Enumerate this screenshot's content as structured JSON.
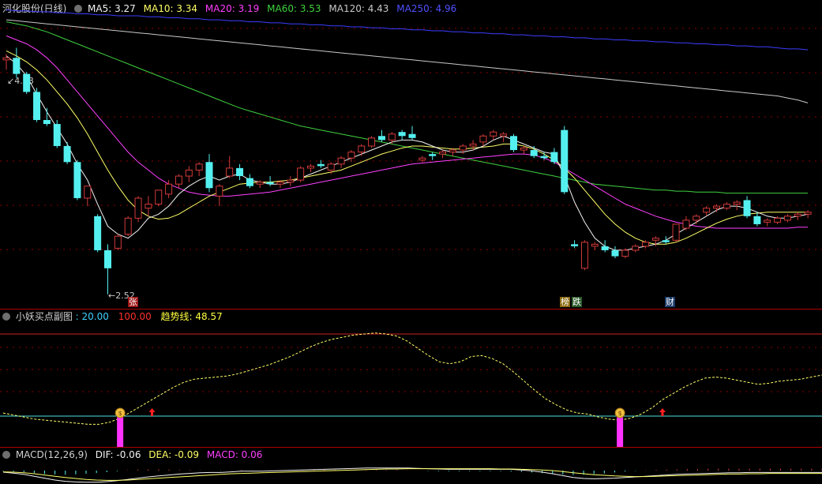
{
  "colors": {
    "bg": "#000000",
    "up": "#d23a3a",
    "down": "#54f0f0",
    "ma5": "#f2f2f2",
    "ma10": "#ffff66",
    "ma20": "#ff40ff",
    "ma60": "#3fd13f",
    "ma120": "#c8c8c8",
    "ma250": "#3c3cff",
    "grid": "#8b0000",
    "signal": "#ff33ff",
    "baseline": "#4fe0e0",
    "trend": "#ffff66"
  },
  "main": {
    "title": "河化股份(日线)",
    "ma5_label": "MA5: 3.27",
    "ma10_label": "MA10: 3.34",
    "ma20_label": "MA20: 3.19",
    "ma60_label": "MA60: 3.53",
    "ma120_label": "MA120: 4.43",
    "ma250_label": "MA250: 4.96",
    "high_marker": "4.98",
    "low_marker": "2.52",
    "tags": [
      "张",
      "榜",
      "跌",
      "财"
    ]
  },
  "sub1": {
    "title": "小妖买点副图",
    "v1_label": ": 20.00",
    "v2_label": "100.00",
    "trend_label": "趋势线: 48.57",
    "signal_icon": "$"
  },
  "sub2": {
    "title": "MACD(12,26,9)",
    "dif_label": "DIF: -0.06",
    "dea_label": "DEA: -0.09",
    "macd_label": "MACD: 0.06"
  },
  "chart_data": {
    "type": "candlestick",
    "price_ylim": [
      2.4,
      5.3
    ],
    "ohlc": [
      [
        4.86,
        4.92,
        4.76,
        4.88
      ],
      [
        4.88,
        4.98,
        4.68,
        4.72
      ],
      [
        4.72,
        4.74,
        4.52,
        4.54
      ],
      [
        4.54,
        4.58,
        4.24,
        4.26
      ],
      [
        4.26,
        4.38,
        4.2,
        4.22
      ],
      [
        4.22,
        4.26,
        3.98,
        4.0
      ],
      [
        4.0,
        4.04,
        3.82,
        3.84
      ],
      [
        3.84,
        3.86,
        3.46,
        3.48
      ],
      [
        3.48,
        3.6,
        3.4,
        3.6
      ],
      [
        3.3,
        3.32,
        2.94,
        2.96
      ],
      [
        2.96,
        3.02,
        2.52,
        2.78
      ],
      [
        2.98,
        3.12,
        2.96,
        3.1
      ],
      [
        3.12,
        3.3,
        3.1,
        3.28
      ],
      [
        3.28,
        3.5,
        3.24,
        3.48
      ],
      [
        3.38,
        3.5,
        3.3,
        3.42
      ],
      [
        3.42,
        3.56,
        3.4,
        3.56
      ],
      [
        3.52,
        3.66,
        3.48,
        3.62
      ],
      [
        3.62,
        3.72,
        3.58,
        3.7
      ],
      [
        3.7,
        3.8,
        3.64,
        3.76
      ],
      [
        3.76,
        3.84,
        3.7,
        3.82
      ],
      [
        3.84,
        3.92,
        3.54,
        3.58
      ],
      [
        3.5,
        3.62,
        3.4,
        3.6
      ],
      [
        3.7,
        3.9,
        3.68,
        3.78
      ],
      [
        3.78,
        3.82,
        3.66,
        3.7
      ],
      [
        3.68,
        3.72,
        3.58,
        3.6
      ],
      [
        3.62,
        3.66,
        3.58,
        3.64
      ],
      [
        3.64,
        3.7,
        3.6,
        3.62
      ],
      [
        3.62,
        3.66,
        3.58,
        3.64
      ],
      [
        3.64,
        3.7,
        3.6,
        3.66
      ],
      [
        3.66,
        3.8,
        3.64,
        3.78
      ],
      [
        3.78,
        3.82,
        3.74,
        3.8
      ],
      [
        3.82,
        3.86,
        3.78,
        3.8
      ],
      [
        3.76,
        3.84,
        3.72,
        3.82
      ],
      [
        3.82,
        3.9,
        3.78,
        3.88
      ],
      [
        3.88,
        3.96,
        3.84,
        3.94
      ],
      [
        3.94,
        4.02,
        3.9,
        4.0
      ],
      [
        4.0,
        4.1,
        3.98,
        4.08
      ],
      [
        4.1,
        4.16,
        4.04,
        4.06
      ],
      [
        4.06,
        4.14,
        4.02,
        4.12
      ],
      [
        4.14,
        4.16,
        4.06,
        4.1
      ],
      [
        4.12,
        4.2,
        4.06,
        4.08
      ],
      [
        3.86,
        3.9,
        3.84,
        3.88
      ],
      [
        3.92,
        3.94,
        3.86,
        3.9
      ],
      [
        3.92,
        3.96,
        3.88,
        3.94
      ],
      [
        3.94,
        3.98,
        3.9,
        3.96
      ],
      [
        3.96,
        4.02,
        3.92,
        4.0
      ],
      [
        4.0,
        4.06,
        3.96,
        4.02
      ],
      [
        4.04,
        4.12,
        4.0,
        4.1
      ],
      [
        4.1,
        4.16,
        4.06,
        4.14
      ],
      [
        4.1,
        4.14,
        4.04,
        4.12
      ],
      [
        4.1,
        4.12,
        3.94,
        3.96
      ],
      [
        3.96,
        4.0,
        3.92,
        3.98
      ],
      [
        3.96,
        4.0,
        3.88,
        3.9
      ],
      [
        3.9,
        3.94,
        3.86,
        3.88
      ],
      [
        3.94,
        3.98,
        3.82,
        3.84
      ],
      [
        4.16,
        4.2,
        3.52,
        3.54
      ],
      [
        3.02,
        3.06,
        2.98,
        3.0
      ],
      [
        2.78,
        3.06,
        2.76,
        3.04
      ],
      [
        3.0,
        3.04,
        2.96,
        3.02
      ],
      [
        3.0,
        3.06,
        2.94,
        2.96
      ],
      [
        2.96,
        3.0,
        2.88,
        2.9
      ],
      [
        2.9,
        2.98,
        2.88,
        2.96
      ],
      [
        2.96,
        3.02,
        2.94,
        3.0
      ],
      [
        3.0,
        3.06,
        2.98,
        3.04
      ],
      [
        3.06,
        3.1,
        3.0,
        3.08
      ],
      [
        3.06,
        3.1,
        3.02,
        3.04
      ],
      [
        3.06,
        3.22,
        3.04,
        3.22
      ],
      [
        3.18,
        3.3,
        3.16,
        3.26
      ],
      [
        3.26,
        3.32,
        3.22,
        3.3
      ],
      [
        3.34,
        3.4,
        3.3,
        3.38
      ],
      [
        3.38,
        3.42,
        3.34,
        3.4
      ],
      [
        3.38,
        3.44,
        3.36,
        3.42
      ],
      [
        3.42,
        3.46,
        3.36,
        3.44
      ],
      [
        3.46,
        3.5,
        3.28,
        3.3
      ],
      [
        3.3,
        3.34,
        3.2,
        3.22
      ],
      [
        3.24,
        3.28,
        3.2,
        3.26
      ],
      [
        3.24,
        3.3,
        3.22,
        3.28
      ],
      [
        3.26,
        3.32,
        3.24,
        3.3
      ],
      [
        3.3,
        3.34,
        3.26,
        3.32
      ],
      [
        3.32,
        3.36,
        3.28,
        3.34
      ]
    ],
    "ma5": [
      4.9,
      4.82,
      4.7,
      4.52,
      4.34,
      4.18,
      4.02,
      3.82,
      3.66,
      3.42,
      3.2,
      3.12,
      3.08,
      3.16,
      3.28,
      3.32,
      3.4,
      3.52,
      3.6,
      3.66,
      3.7,
      3.66,
      3.7,
      3.72,
      3.66,
      3.64,
      3.62,
      3.62,
      3.64,
      3.68,
      3.72,
      3.76,
      3.8,
      3.84,
      3.88,
      3.92,
      3.96,
      4.0,
      4.04,
      4.06,
      4.06,
      4.04,
      4.0,
      3.96,
      3.94,
      3.94,
      3.96,
      4.0,
      4.06,
      4.1,
      4.06,
      4.02,
      3.98,
      3.94,
      3.92,
      3.7,
      3.44,
      3.24,
      3.08,
      3.0,
      2.96,
      2.96,
      2.98,
      3.0,
      3.02,
      3.06,
      3.12,
      3.18,
      3.24,
      3.3,
      3.36,
      3.4,
      3.4,
      3.38,
      3.34,
      3.3,
      3.28,
      3.28,
      3.3,
      3.32
    ],
    "ma10": [
      4.95,
      4.9,
      4.84,
      4.76,
      4.66,
      4.54,
      4.42,
      4.28,
      4.12,
      3.94,
      3.76,
      3.6,
      3.46,
      3.36,
      3.3,
      3.27,
      3.28,
      3.32,
      3.38,
      3.44,
      3.5,
      3.54,
      3.58,
      3.62,
      3.63,
      3.64,
      3.64,
      3.65,
      3.66,
      3.68,
      3.7,
      3.72,
      3.74,
      3.76,
      3.8,
      3.84,
      3.88,
      3.92,
      3.95,
      3.98,
      4.0,
      4.0,
      3.99,
      3.98,
      3.97,
      3.97,
      3.98,
      3.99,
      4.0,
      4.02,
      4.02,
      4.0,
      3.97,
      3.92,
      3.86,
      3.78,
      3.68,
      3.56,
      3.44,
      3.32,
      3.22,
      3.14,
      3.08,
      3.04,
      3.02,
      3.02,
      3.04,
      3.08,
      3.13,
      3.18,
      3.23,
      3.27,
      3.3,
      3.32,
      3.33,
      3.34,
      3.34,
      3.34,
      3.34,
      3.34
    ],
    "ma20": [
      5.1,
      5.06,
      5.02,
      4.96,
      4.88,
      4.78,
      4.66,
      4.54,
      4.42,
      4.3,
      4.18,
      4.06,
      3.94,
      3.84,
      3.76,
      3.68,
      3.62,
      3.58,
      3.54,
      3.52,
      3.51,
      3.5,
      3.5,
      3.51,
      3.52,
      3.53,
      3.54,
      3.56,
      3.58,
      3.6,
      3.62,
      3.64,
      3.66,
      3.68,
      3.7,
      3.72,
      3.74,
      3.76,
      3.78,
      3.8,
      3.82,
      3.83,
      3.84,
      3.85,
      3.86,
      3.87,
      3.88,
      3.89,
      3.9,
      3.91,
      3.92,
      3.92,
      3.91,
      3.88,
      3.84,
      3.78,
      3.72,
      3.66,
      3.6,
      3.54,
      3.48,
      3.42,
      3.38,
      3.34,
      3.3,
      3.27,
      3.24,
      3.22,
      3.2,
      3.19,
      3.18,
      3.18,
      3.18,
      3.18,
      3.18,
      3.18,
      3.18,
      3.18,
      3.19,
      3.19
    ],
    "ma60": [
      5.24,
      5.22,
      5.2,
      5.17,
      5.14,
      5.1,
      5.06,
      5.02,
      4.98,
      4.94,
      4.9,
      4.86,
      4.82,
      4.78,
      4.74,
      4.7,
      4.66,
      4.62,
      4.58,
      4.54,
      4.5,
      4.46,
      4.42,
      4.38,
      4.35,
      4.32,
      4.29,
      4.26,
      4.23,
      4.2,
      4.18,
      4.16,
      4.14,
      4.12,
      4.1,
      4.08,
      4.06,
      4.04,
      4.02,
      4.0,
      3.98,
      3.96,
      3.94,
      3.92,
      3.9,
      3.88,
      3.86,
      3.84,
      3.82,
      3.8,
      3.78,
      3.76,
      3.74,
      3.72,
      3.7,
      3.68,
      3.66,
      3.64,
      3.62,
      3.61,
      3.6,
      3.59,
      3.58,
      3.57,
      3.56,
      3.56,
      3.55,
      3.55,
      3.54,
      3.54,
      3.54,
      3.53,
      3.53,
      3.53,
      3.53,
      3.53,
      3.53,
      3.53,
      3.53,
      3.53
    ],
    "ma120": [
      5.26,
      5.25,
      5.24,
      5.23,
      5.22,
      5.21,
      5.2,
      5.19,
      5.18,
      5.17,
      5.16,
      5.15,
      5.14,
      5.13,
      5.12,
      5.11,
      5.1,
      5.09,
      5.08,
      5.07,
      5.06,
      5.05,
      5.04,
      5.03,
      5.02,
      5.01,
      5.0,
      4.99,
      4.98,
      4.97,
      4.96,
      4.95,
      4.94,
      4.93,
      4.92,
      4.91,
      4.9,
      4.89,
      4.88,
      4.87,
      4.86,
      4.85,
      4.84,
      4.83,
      4.82,
      4.81,
      4.8,
      4.79,
      4.78,
      4.77,
      4.76,
      4.75,
      4.74,
      4.73,
      4.72,
      4.71,
      4.7,
      4.69,
      4.68,
      4.67,
      4.66,
      4.65,
      4.64,
      4.63,
      4.62,
      4.61,
      4.6,
      4.59,
      4.58,
      4.57,
      4.56,
      4.55,
      4.54,
      4.53,
      4.52,
      4.51,
      4.5,
      4.48,
      4.46,
      4.43
    ],
    "ma250": [
      5.36,
      5.35,
      5.35,
      5.34,
      5.34,
      5.33,
      5.33,
      5.32,
      5.32,
      5.31,
      5.31,
      5.3,
      5.3,
      5.3,
      5.29,
      5.29,
      5.28,
      5.28,
      5.27,
      5.27,
      5.26,
      5.26,
      5.25,
      5.25,
      5.24,
      5.24,
      5.23,
      5.23,
      5.22,
      5.22,
      5.21,
      5.21,
      5.2,
      5.2,
      5.19,
      5.19,
      5.18,
      5.18,
      5.17,
      5.17,
      5.16,
      5.16,
      5.15,
      5.15,
      5.14,
      5.14,
      5.13,
      5.13,
      5.12,
      5.12,
      5.11,
      5.11,
      5.1,
      5.1,
      5.09,
      5.09,
      5.08,
      5.08,
      5.07,
      5.07,
      5.06,
      5.06,
      5.05,
      5.05,
      5.04,
      5.04,
      5.03,
      5.03,
      5.02,
      5.02,
      5.01,
      5.01,
      5.0,
      5.0,
      4.99,
      4.99,
      4.98,
      4.97,
      4.97,
      4.96
    ],
    "trend_ylim": [
      -10,
      110
    ],
    "trend": [
      23,
      21,
      19,
      17,
      16,
      15,
      14,
      13,
      12,
      12,
      14,
      18,
      24,
      30,
      36,
      42,
      48,
      53,
      56,
      57,
      58,
      59,
      61,
      64,
      67,
      70,
      74,
      78,
      83,
      88,
      92,
      95,
      97,
      99,
      100,
      101,
      100,
      98,
      93,
      86,
      79,
      73,
      71,
      73,
      78,
      79,
      76,
      71,
      63,
      54,
      45,
      37,
      31,
      26,
      23,
      22,
      19,
      17,
      16,
      18,
      22,
      28,
      36,
      42,
      48,
      53,
      57,
      58,
      57,
      55,
      53,
      51,
      52,
      54,
      55,
      56,
      58,
      60
    ],
    "signal_bars_index": [
      11,
      58
    ],
    "arrows_index": [
      14,
      62
    ],
    "macd_hist": [
      -0.02,
      -0.03,
      -0.05,
      -0.08,
      -0.1,
      -0.12,
      -0.13,
      -0.12,
      -0.1,
      -0.08,
      -0.05,
      -0.02,
      0.01,
      0.03,
      0.04,
      0.04,
      0.03,
      0.02,
      0.02,
      0.01,
      0.0,
      -0.01,
      0.01,
      0.02,
      0.01,
      0.0,
      0.0,
      0.01,
      0.01,
      0.02,
      0.02,
      0.03,
      0.03,
      0.03,
      0.03,
      0.03,
      0.02,
      0.02,
      0.02,
      0.01,
      0.0,
      -0.01,
      -0.02,
      -0.02,
      -0.02,
      -0.02,
      -0.02,
      -0.02,
      -0.02,
      -0.03,
      -0.04,
      -0.06,
      -0.08,
      -0.1,
      -0.12,
      -0.14,
      -0.13,
      -0.11,
      -0.09,
      -0.06,
      -0.03,
      -0.01,
      0.01,
      0.02,
      0.03,
      0.04,
      0.05,
      0.05,
      0.06,
      0.06,
      0.06,
      0.06,
      0.06,
      0.06,
      0.06,
      0.06,
      0.06,
      0.06,
      0.06,
      0.06
    ],
    "dif": [
      -0.05,
      -0.08,
      -0.12,
      -0.18,
      -0.24,
      -0.3,
      -0.34,
      -0.36,
      -0.37,
      -0.37,
      -0.35,
      -0.32,
      -0.28,
      -0.24,
      -0.2,
      -0.17,
      -0.14,
      -0.11,
      -0.09,
      -0.07,
      -0.06,
      -0.06,
      -0.04,
      -0.02,
      -0.02,
      -0.02,
      -0.01,
      0.0,
      0.01,
      0.02,
      0.03,
      0.04,
      0.05,
      0.06,
      0.07,
      0.08,
      0.08,
      0.08,
      0.08,
      0.08,
      0.07,
      0.06,
      0.05,
      0.04,
      0.04,
      0.04,
      0.04,
      0.04,
      0.04,
      0.04,
      0.02,
      -0.01,
      -0.05,
      -0.1,
      -0.16,
      -0.22,
      -0.25,
      -0.26,
      -0.25,
      -0.24,
      -0.22,
      -0.2,
      -0.18,
      -0.16,
      -0.14,
      -0.12,
      -0.11,
      -0.1,
      -0.09,
      -0.08,
      -0.07,
      -0.07,
      -0.06,
      -0.06,
      -0.06,
      -0.06,
      -0.06,
      -0.06,
      -0.06,
      -0.06
    ],
    "dea": [
      -0.04,
      -0.05,
      -0.07,
      -0.1,
      -0.14,
      -0.18,
      -0.22,
      -0.25,
      -0.28,
      -0.3,
      -0.31,
      -0.31,
      -0.3,
      -0.28,
      -0.26,
      -0.24,
      -0.22,
      -0.2,
      -0.18,
      -0.16,
      -0.14,
      -0.12,
      -0.1,
      -0.09,
      -0.08,
      -0.07,
      -0.06,
      -0.05,
      -0.04,
      -0.03,
      -0.02,
      -0.01,
      0.0,
      0.01,
      0.02,
      0.03,
      0.04,
      0.05,
      0.05,
      0.06,
      0.06,
      0.06,
      0.06,
      0.06,
      0.06,
      0.06,
      0.06,
      0.06,
      0.05,
      0.05,
      0.04,
      0.03,
      0.02,
      0.0,
      -0.03,
      -0.07,
      -0.1,
      -0.13,
      -0.15,
      -0.17,
      -0.18,
      -0.19,
      -0.19,
      -0.18,
      -0.17,
      -0.16,
      -0.15,
      -0.14,
      -0.13,
      -0.12,
      -0.11,
      -0.11,
      -0.1,
      -0.1,
      -0.09,
      -0.09,
      -0.09,
      -0.09,
      -0.09,
      -0.09
    ]
  }
}
